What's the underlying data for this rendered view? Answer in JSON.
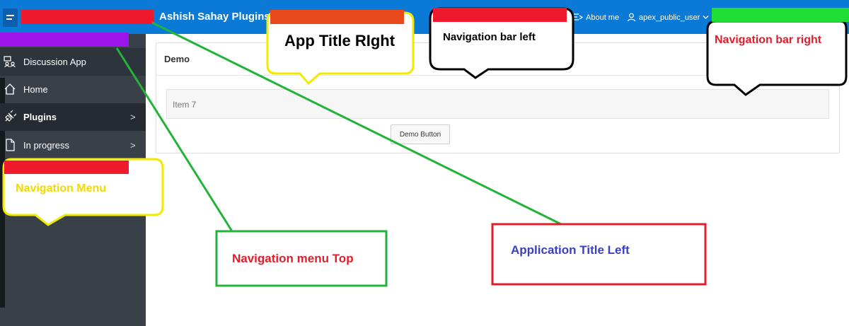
{
  "header": {
    "app_title": "Ashish Sahay Plugins",
    "about_label": "About me",
    "user_label": "apex_public_user",
    "bg_color": "#0a7ad6"
  },
  "sidebar": {
    "items": [
      {
        "label": "Discussion App",
        "icon": "discussion-icon"
      },
      {
        "label": "Home",
        "icon": "home-icon"
      },
      {
        "label": "Plugins",
        "icon": "plug-icon",
        "chevron": ">"
      },
      {
        "label": "In progress",
        "icon": "document-icon",
        "chevron": ">"
      }
    ]
  },
  "main": {
    "region_title": "Demo",
    "item_label": "Item 7",
    "button_label": "Demo Button"
  },
  "annotations": {
    "app_title_right": "App Title RIght",
    "nav_bar_left": "Navigation bar left",
    "nav_bar_right": "Navigation bar right",
    "nav_menu": "Navigation Menu",
    "nav_menu_top": "Navigation menu Top",
    "app_title_left": "Application Title Left"
  },
  "colors": {
    "highlight_red": "#ef1a2e",
    "highlight_orange": "#e84a1c",
    "highlight_green": "#1fdd34",
    "highlight_purple": "#9b16ea",
    "callout_yellow": "#f2e900",
    "arrow_green": "#23b23a"
  }
}
